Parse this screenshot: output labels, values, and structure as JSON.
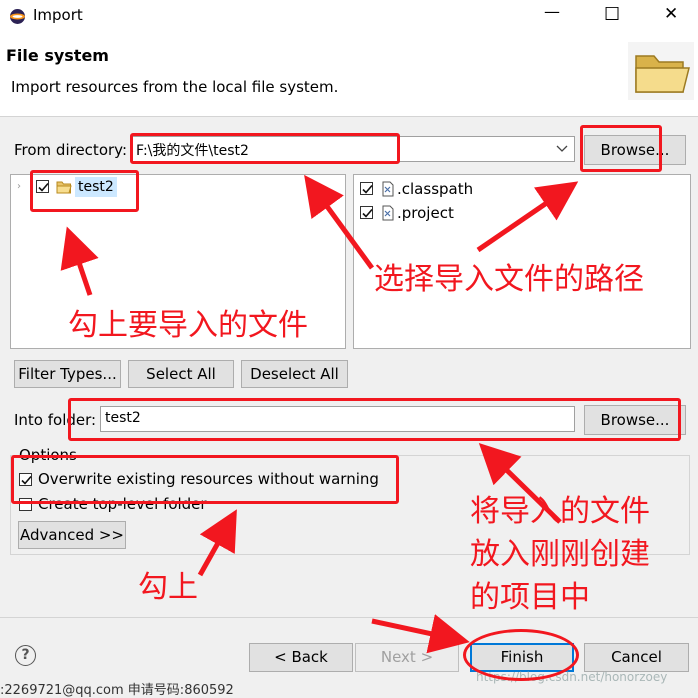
{
  "window": {
    "title": "Import",
    "controls": {
      "minimize": "—",
      "maximize": "☐",
      "close": "✕"
    }
  },
  "header": {
    "title": "File system",
    "description": "Import resources from the local file system."
  },
  "source": {
    "label": "From directory:",
    "value": "F:\\我的文件\\test2",
    "browse_label": "Browse..."
  },
  "tree": {
    "folder_label": "test2",
    "folder_checked": true
  },
  "files": [
    {
      "name": ".classpath",
      "checked": true
    },
    {
      "name": ".project",
      "checked": true
    }
  ],
  "buttons": {
    "filter_types": "Filter Types...",
    "select_all": "Select All",
    "deselect_all": "Deselect All"
  },
  "destination": {
    "label": "Into folder:",
    "value": "test2",
    "browse_label": "Browse..."
  },
  "options": {
    "legend": "Options",
    "overwrite_label": "Overwrite existing resources without warning",
    "overwrite_checked": true,
    "create_top_label": "Create top-level folder",
    "create_top_checked": false,
    "advanced_label": "Advanced >>"
  },
  "footer": {
    "back_label": "< Back",
    "next_label": "Next >",
    "finish_label": "Finish",
    "cancel_label": "Cancel",
    "help_icon": "?"
  },
  "annotations": {
    "path_note": "选择导入文件的路径",
    "check_note": "勾上要导入的文件",
    "folder_note_line1": "将导入的文件",
    "folder_note_line2": "放入刚刚创建",
    "folder_note_line3": "的项目中",
    "checkbox_note": "勾上"
  },
  "colors": {
    "annotation_red": "#f2171f",
    "window_bg": "#f0f0f0"
  },
  "watermark": {
    "left_text": ":2269721@qq.com  申请号码:860592",
    "right_text": "https://blog.csdn.net/honorzoey"
  }
}
